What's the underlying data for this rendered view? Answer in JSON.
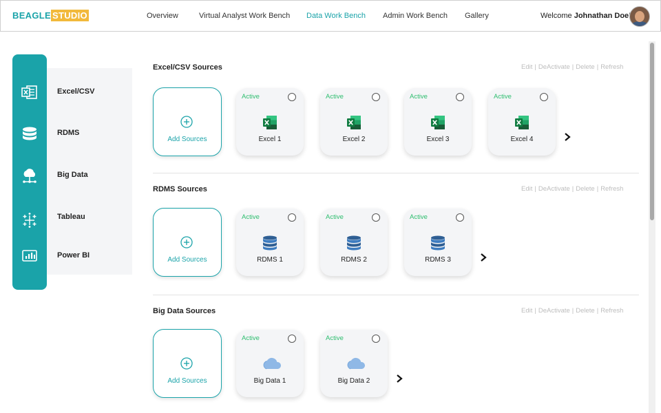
{
  "brand": {
    "part1": "BEAGLE",
    "part2": "STUDIO"
  },
  "nav": [
    {
      "label": "Overview",
      "active": false
    },
    {
      "label": "Virtual Analyst Work Bench",
      "active": false
    },
    {
      "label": "Data Work Bench",
      "active": true
    },
    {
      "label": "Admin Work Bench",
      "active": false
    },
    {
      "label": "Gallery",
      "active": false
    }
  ],
  "user": {
    "welcome": "Welcome",
    "name": "Johnathan Doe!"
  },
  "sidebar": {
    "items": [
      {
        "label": "Excel/CSV",
        "icon": "excel-icon"
      },
      {
        "label": "RDMS",
        "icon": "database-icon"
      },
      {
        "label": "Big Data",
        "icon": "cloud-network-icon"
      },
      {
        "label": "Tableau",
        "icon": "tableau-icon"
      },
      {
        "label": "Power BI",
        "icon": "power-bi-icon"
      }
    ]
  },
  "actions": {
    "edit": "Edit",
    "deactivate": "DeActivate",
    "delete": "Delete",
    "refresh": "Refresh",
    "separator": "|"
  },
  "add_label": "Add Sources",
  "colors": {
    "accent": "#1aa3a9",
    "active_status": "#2dbd6e",
    "brand_highlight": "#f2b93b"
  },
  "sections": [
    {
      "title": "Excel/CSV Sources",
      "icon": "excel-icon",
      "cards": [
        {
          "status": "Active",
          "name": "Excel 1"
        },
        {
          "status": "Active",
          "name": "Excel 2"
        },
        {
          "status": "Active",
          "name": "Excel 3"
        },
        {
          "status": "Active",
          "name": "Excel 4"
        }
      ]
    },
    {
      "title": "RDMS Sources",
      "icon": "database-icon",
      "cards": [
        {
          "status": "Active",
          "name": "RDMS 1"
        },
        {
          "status": "Active",
          "name": "RDMS 2"
        },
        {
          "status": "Active",
          "name": "RDMS 3"
        }
      ]
    },
    {
      "title": "Big Data Sources",
      "icon": "cloud-icon",
      "cards": [
        {
          "status": "Active",
          "name": "Big Data 1"
        },
        {
          "status": "Active",
          "name": "Big Data 2"
        }
      ]
    }
  ]
}
